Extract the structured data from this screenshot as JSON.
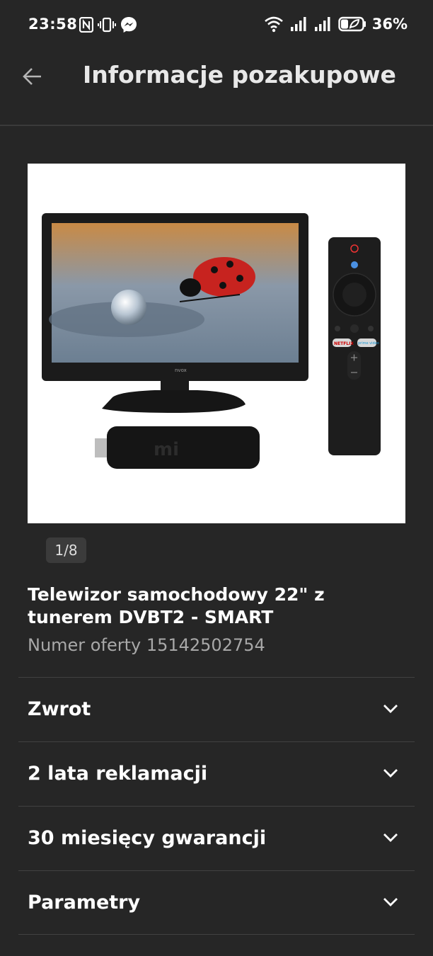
{
  "status_bar": {
    "time": "23:58",
    "battery_percent": "36%",
    "icons": [
      "nfc-icon",
      "vibrate-icon",
      "messenger-icon",
      "wifi-icon",
      "signal-icon",
      "signal-icon",
      "battery-saver-icon"
    ]
  },
  "header": {
    "back_icon": "arrow-left-icon",
    "title": "Informacje pozakupowe"
  },
  "gallery": {
    "counter": "1/8",
    "image_brand_text": "nvox",
    "remote_netflix_text": "NETFLIX",
    "remote_prime_text": "prime video",
    "stick_logo_text": "mi"
  },
  "product": {
    "title": "Telewizor samochodowy 22\" z tunerem DVBT2 - SMART",
    "offer": "Numer oferty 15142502754"
  },
  "sections": [
    {
      "label": "Zwrot",
      "icon": "chevron-down-icon"
    },
    {
      "label": "2 lata reklamacji",
      "icon": "chevron-down-icon"
    },
    {
      "label": "30 miesięcy gwarancji",
      "icon": "chevron-down-icon"
    },
    {
      "label": "Parametry",
      "icon": "chevron-down-icon"
    }
  ],
  "colors": {
    "background": "#262626",
    "text": "#ffffff",
    "muted_text": "#a8a8a8",
    "divider": "#414141",
    "counter_bg": "#3b3b3b"
  }
}
